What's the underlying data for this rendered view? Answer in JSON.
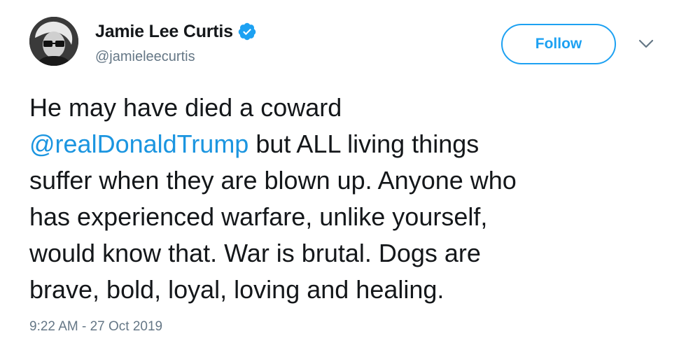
{
  "user": {
    "display_name": "Jamie Lee Curtis",
    "handle": "@jamieleecurtis",
    "verified": true,
    "avatar_icon": "profile-photo"
  },
  "actions": {
    "follow_label": "Follow",
    "menu_icon": "chevron-down-icon"
  },
  "tweet": {
    "lines": [
      {
        "text": "He may have died a coward"
      },
      {
        "mention": "@realDonaldTrump",
        "text": " but ALL living things"
      },
      {
        "text": "suffer when they are blown up. Anyone who"
      },
      {
        "text": "has experienced warfare, unlike yourself,"
      },
      {
        "text": "would know that. War is brutal. Dogs are"
      },
      {
        "text": "brave, bold, loyal, loving and healing."
      }
    ],
    "timestamp": "9:22 AM - 27 Oct 2019"
  },
  "colors": {
    "accent": "#1da1f2",
    "mention": "#1b95e0",
    "text": "#14171a",
    "muted": "#657786"
  }
}
